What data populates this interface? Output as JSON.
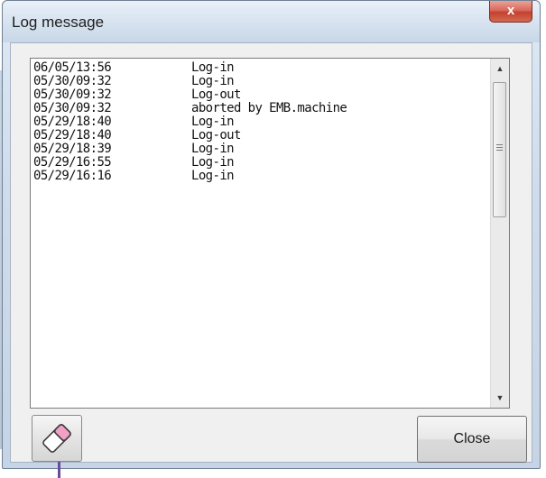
{
  "window": {
    "title": "Log message",
    "close_glyph": "x"
  },
  "log": {
    "rows": [
      {
        "time": "06/05/13:56",
        "message": "Log-in"
      },
      {
        "time": "05/30/09:32",
        "message": "Log-in"
      },
      {
        "time": "05/30/09:32",
        "message": "Log-out"
      },
      {
        "time": "05/30/09:32",
        "message": "aborted by EMB.machine"
      },
      {
        "time": "05/29/18:40",
        "message": "Log-in"
      },
      {
        "time": "05/29/18:40",
        "message": "Log-out"
      },
      {
        "time": "05/29/18:39",
        "message": "Log-in"
      },
      {
        "time": "05/29/16:55",
        "message": "Log-in"
      },
      {
        "time": "05/29/16:16",
        "message": "Log-in"
      }
    ]
  },
  "scrollbar": {
    "up_glyph": "▲",
    "down_glyph": "▼"
  },
  "buttons": {
    "clear_icon": "eraser-icon",
    "close_label": "Close"
  },
  "colors": {
    "close_x": "#c2412f",
    "eraser_tip": "#f1a0c8",
    "pointer": "#6a4c9c"
  }
}
